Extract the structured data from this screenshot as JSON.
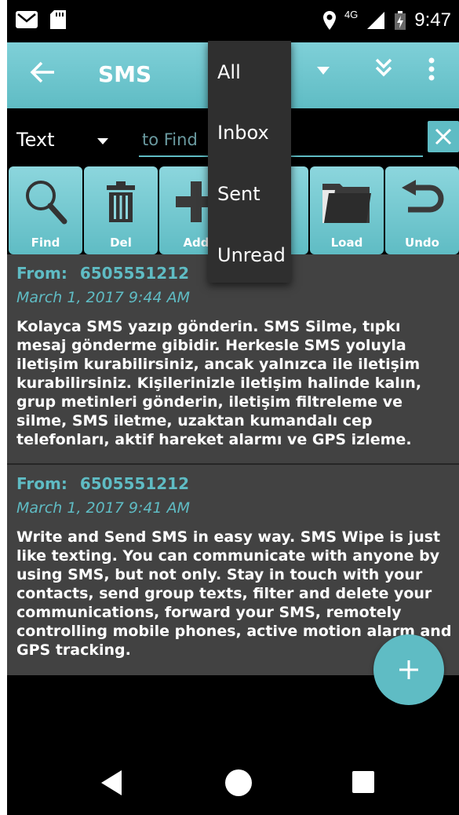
{
  "status_bar": {
    "network": "4G",
    "time": "9:47"
  },
  "app_bar": {
    "title": "SMS"
  },
  "search": {
    "type_label": "Text",
    "placeholder": "to Find"
  },
  "toolbar": {
    "buttons": [
      {
        "label": "Find"
      },
      {
        "label": "Del"
      },
      {
        "label": "Add"
      },
      {
        "label": ""
      },
      {
        "label": "Load"
      },
      {
        "label": "Undo"
      }
    ]
  },
  "dropdown": {
    "items": [
      "All",
      "Inbox",
      "Sent",
      "Unread"
    ]
  },
  "messages": [
    {
      "from_label": "From:",
      "from": "6505551212",
      "date": "March 1, 2017 9:44 AM",
      "body": "Kolayca SMS yazıp gönderin. SMS Silme, tıpkı mesaj gönderme gibidir. Herkesle SMS yoluyla iletişim kurabilirsiniz, ancak yalnızca ile iletişim kurabilirsiniz. Kişilerinizle iletişim halinde kalın, grup metinleri gönderin, iletişim filtreleme ve silme, SMS iletme, uzaktan kumandalı cep telefonları, aktif hareket alarmı ve GPS izleme."
    },
    {
      "from_label": "From:",
      "from": "6505551212",
      "date": "March 1, 2017 9:41 AM",
      "body": "Write and Send SMS in easy way. SMS Wipe is just like texting. You can communicate with anyone by using SMS, but not only. Stay in touch with your contacts, send group texts, filter and delete your communications, forward your SMS, remotely controlling mobile phones, active motion alarm and GPS tracking."
    }
  ],
  "colors": {
    "accent": "#5fbcc4",
    "list_bg": "#424242",
    "menu_bg": "#2f2f2f"
  }
}
